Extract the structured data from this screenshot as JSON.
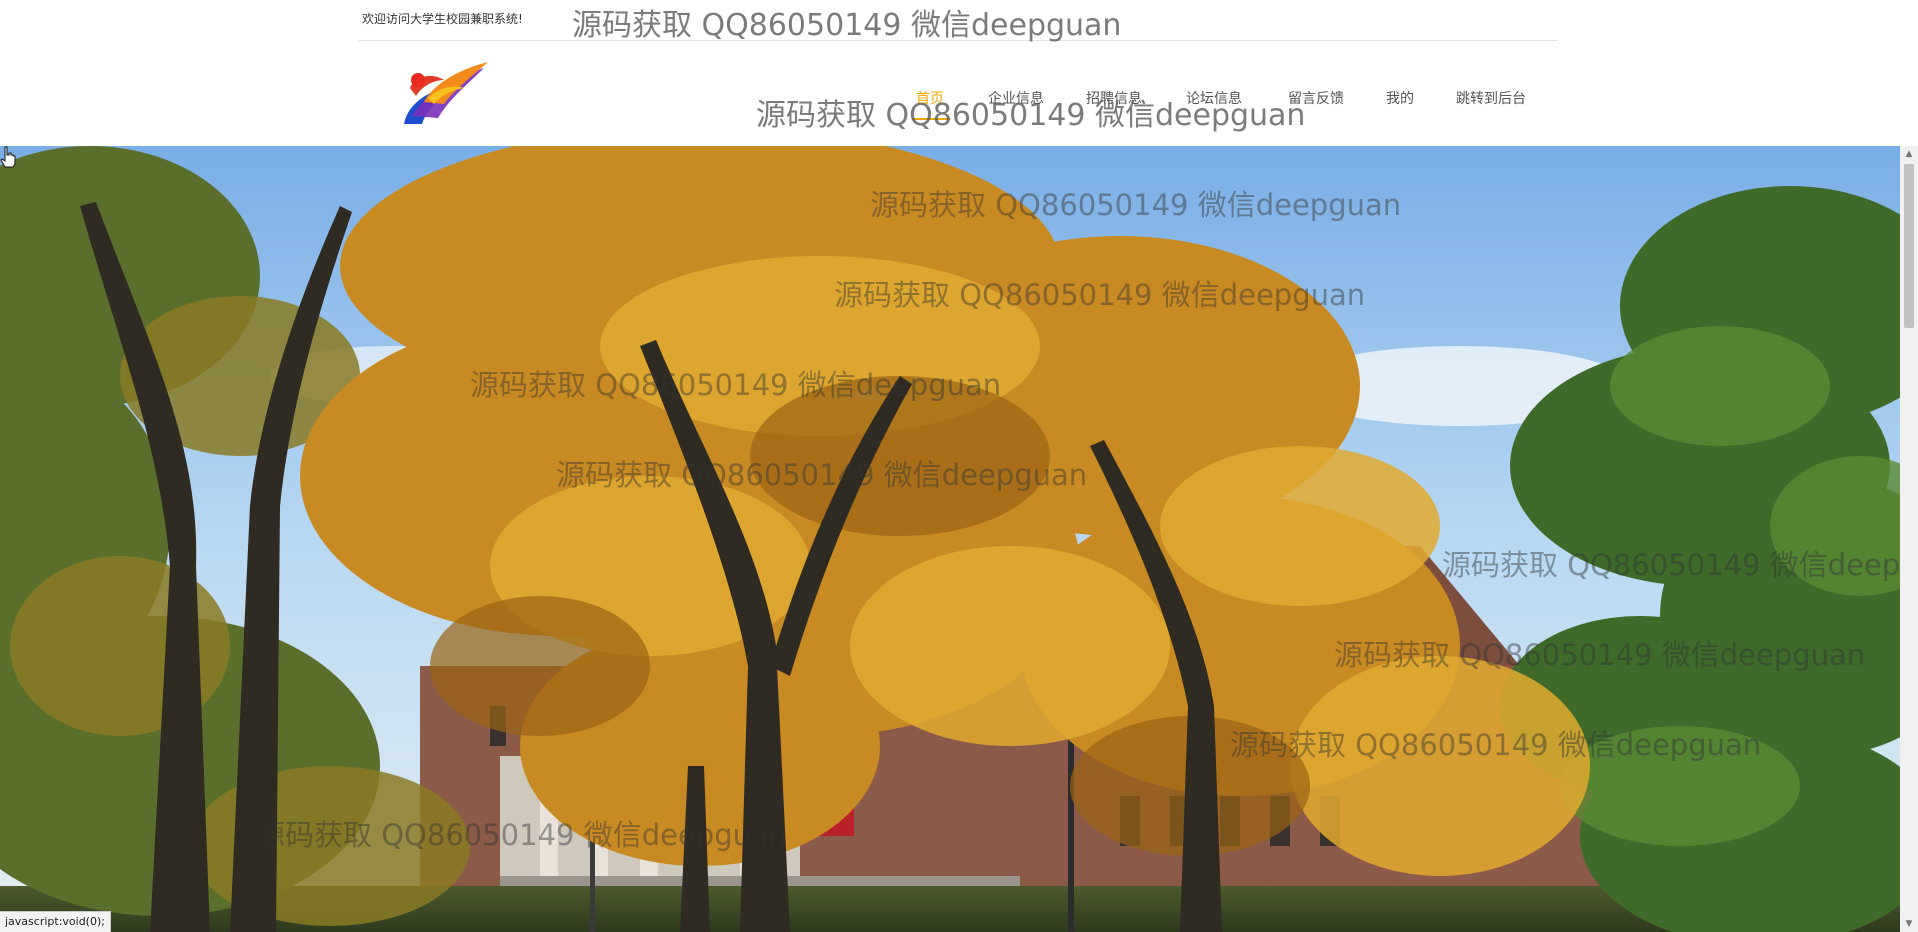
{
  "header": {
    "welcome": "欢迎访问大学生校园兼职系统!",
    "nav": [
      {
        "label": "首页",
        "active": true
      },
      {
        "label": "企业信息",
        "active": false
      },
      {
        "label": "招聘信息",
        "active": false
      },
      {
        "label": "论坛信息",
        "active": false
      },
      {
        "label": "留言反馈",
        "active": false
      },
      {
        "label": "我的",
        "active": false
      },
      {
        "label": "跳转到后台",
        "active": false
      }
    ]
  },
  "watermark": {
    "text": "源码获取 QQ86050149 微信deepguan",
    "text_cut": "源码获取 QQ86050149 微信deepg"
  },
  "statusbar": {
    "text": "javascript:void(0);"
  },
  "colors": {
    "accent": "#f0a800",
    "sky": "#9cc8ec"
  }
}
